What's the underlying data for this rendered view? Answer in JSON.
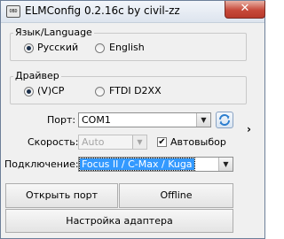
{
  "window": {
    "title": "ELMConfig 0.2.16c by civil-zz",
    "icon_text": "OBD",
    "close_glyph": "✕"
  },
  "language_group": {
    "legend": "Язык/Language",
    "options": [
      {
        "label": "Русский",
        "checked": true
      },
      {
        "label": "English",
        "checked": false
      }
    ]
  },
  "driver_group": {
    "legend": "Драйвер",
    "options": [
      {
        "label": "(V)CP",
        "checked": true
      },
      {
        "label": "FTDI D2XX",
        "checked": false
      }
    ]
  },
  "port": {
    "label": "Порт:",
    "value": "COM1"
  },
  "speed": {
    "label": "Скорость:",
    "value": "Auto",
    "enabled": false
  },
  "autoselect": {
    "label": "Автовыбор",
    "checked": true,
    "check_glyph": "✔"
  },
  "connection": {
    "label": "Подключение:",
    "value": "Focus II / C-Max / Kuga"
  },
  "expand_glyph": "›",
  "buttons": {
    "open_port": "Открыть порт",
    "offline": "Offline",
    "adapter_setup": "Настройка адаптера"
  },
  "colors": {
    "selection": "#3399ff",
    "close": "#c7493a",
    "refresh_icon": "#2d7ecf"
  }
}
